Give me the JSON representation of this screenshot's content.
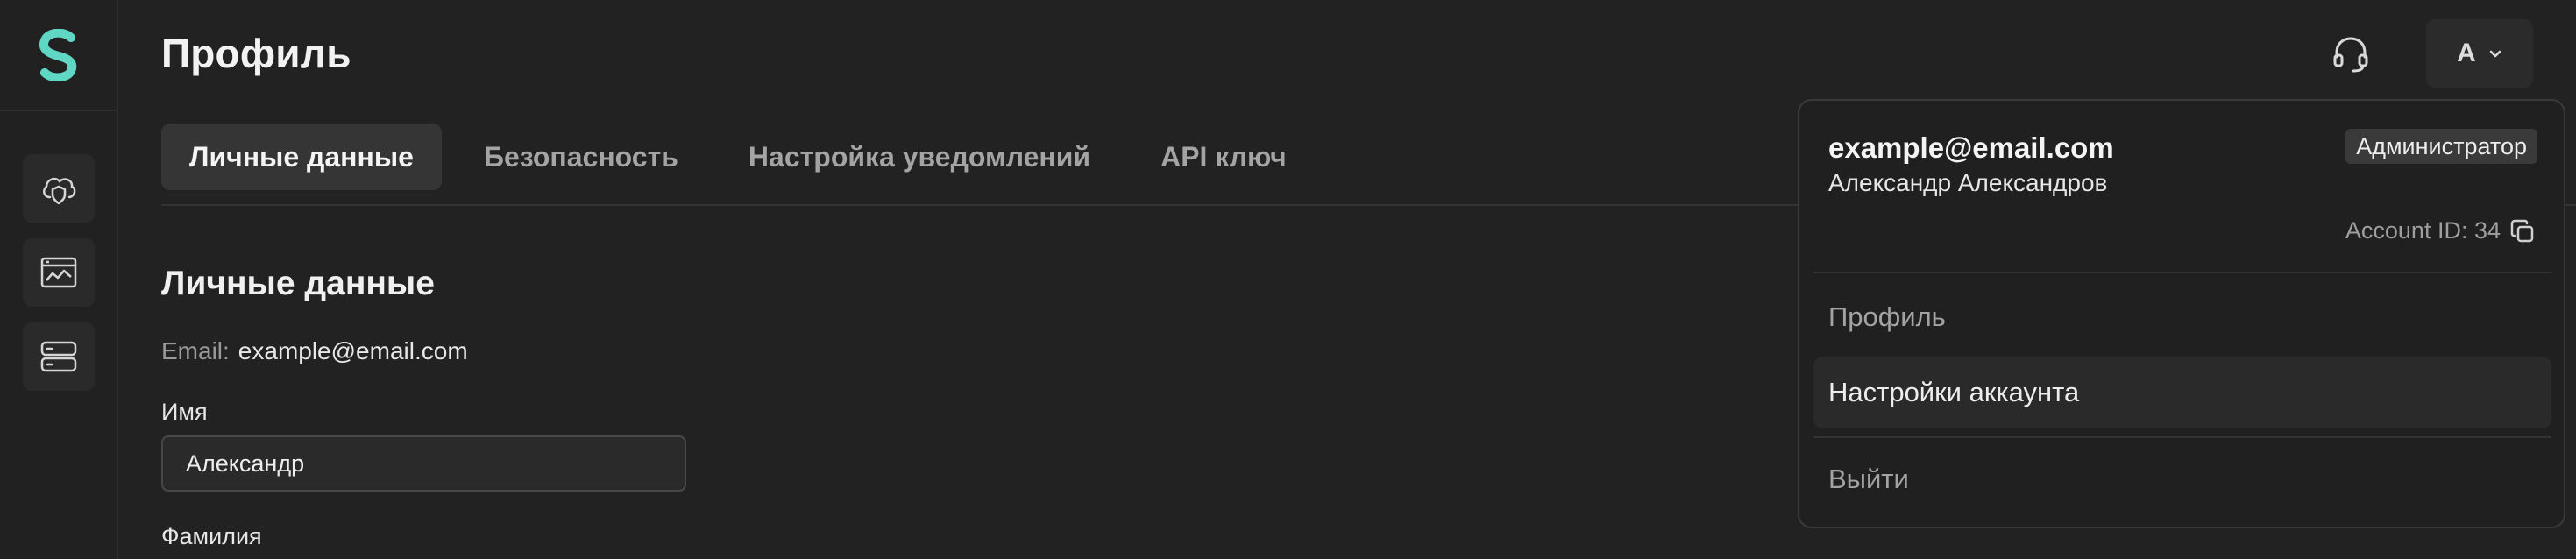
{
  "brand": {
    "accent": "#5fd7c4"
  },
  "sidebar": {
    "logo_icon": "logo-s-icon",
    "items": [
      {
        "icon": "cloud-shield-icon"
      },
      {
        "icon": "browser-chart-icon"
      },
      {
        "icon": "server-icon"
      }
    ]
  },
  "header": {
    "title": "Профиль",
    "support_icon": "headset-icon",
    "avatar_letter": "A"
  },
  "tabs": [
    {
      "label": "Личные данные",
      "active": true
    },
    {
      "label": "Безопасность",
      "active": false
    },
    {
      "label": "Настройка уведомлений",
      "active": false
    },
    {
      "label": "API ключ",
      "active": false
    }
  ],
  "personal": {
    "section_title": "Личные данные",
    "email_label": "Email:",
    "email_value": "example@email.com",
    "first_name_label": "Имя",
    "first_name_value": "Александр",
    "last_name_label": "Фамилия"
  },
  "dropdown": {
    "email": "example@email.com",
    "role": "Администратор",
    "name": "Александр Александров",
    "account_id": "Account ID: 34",
    "items": [
      {
        "label": "Профиль"
      },
      {
        "label": "Настройки аккаунта"
      },
      {
        "label": "Выйти"
      }
    ]
  }
}
